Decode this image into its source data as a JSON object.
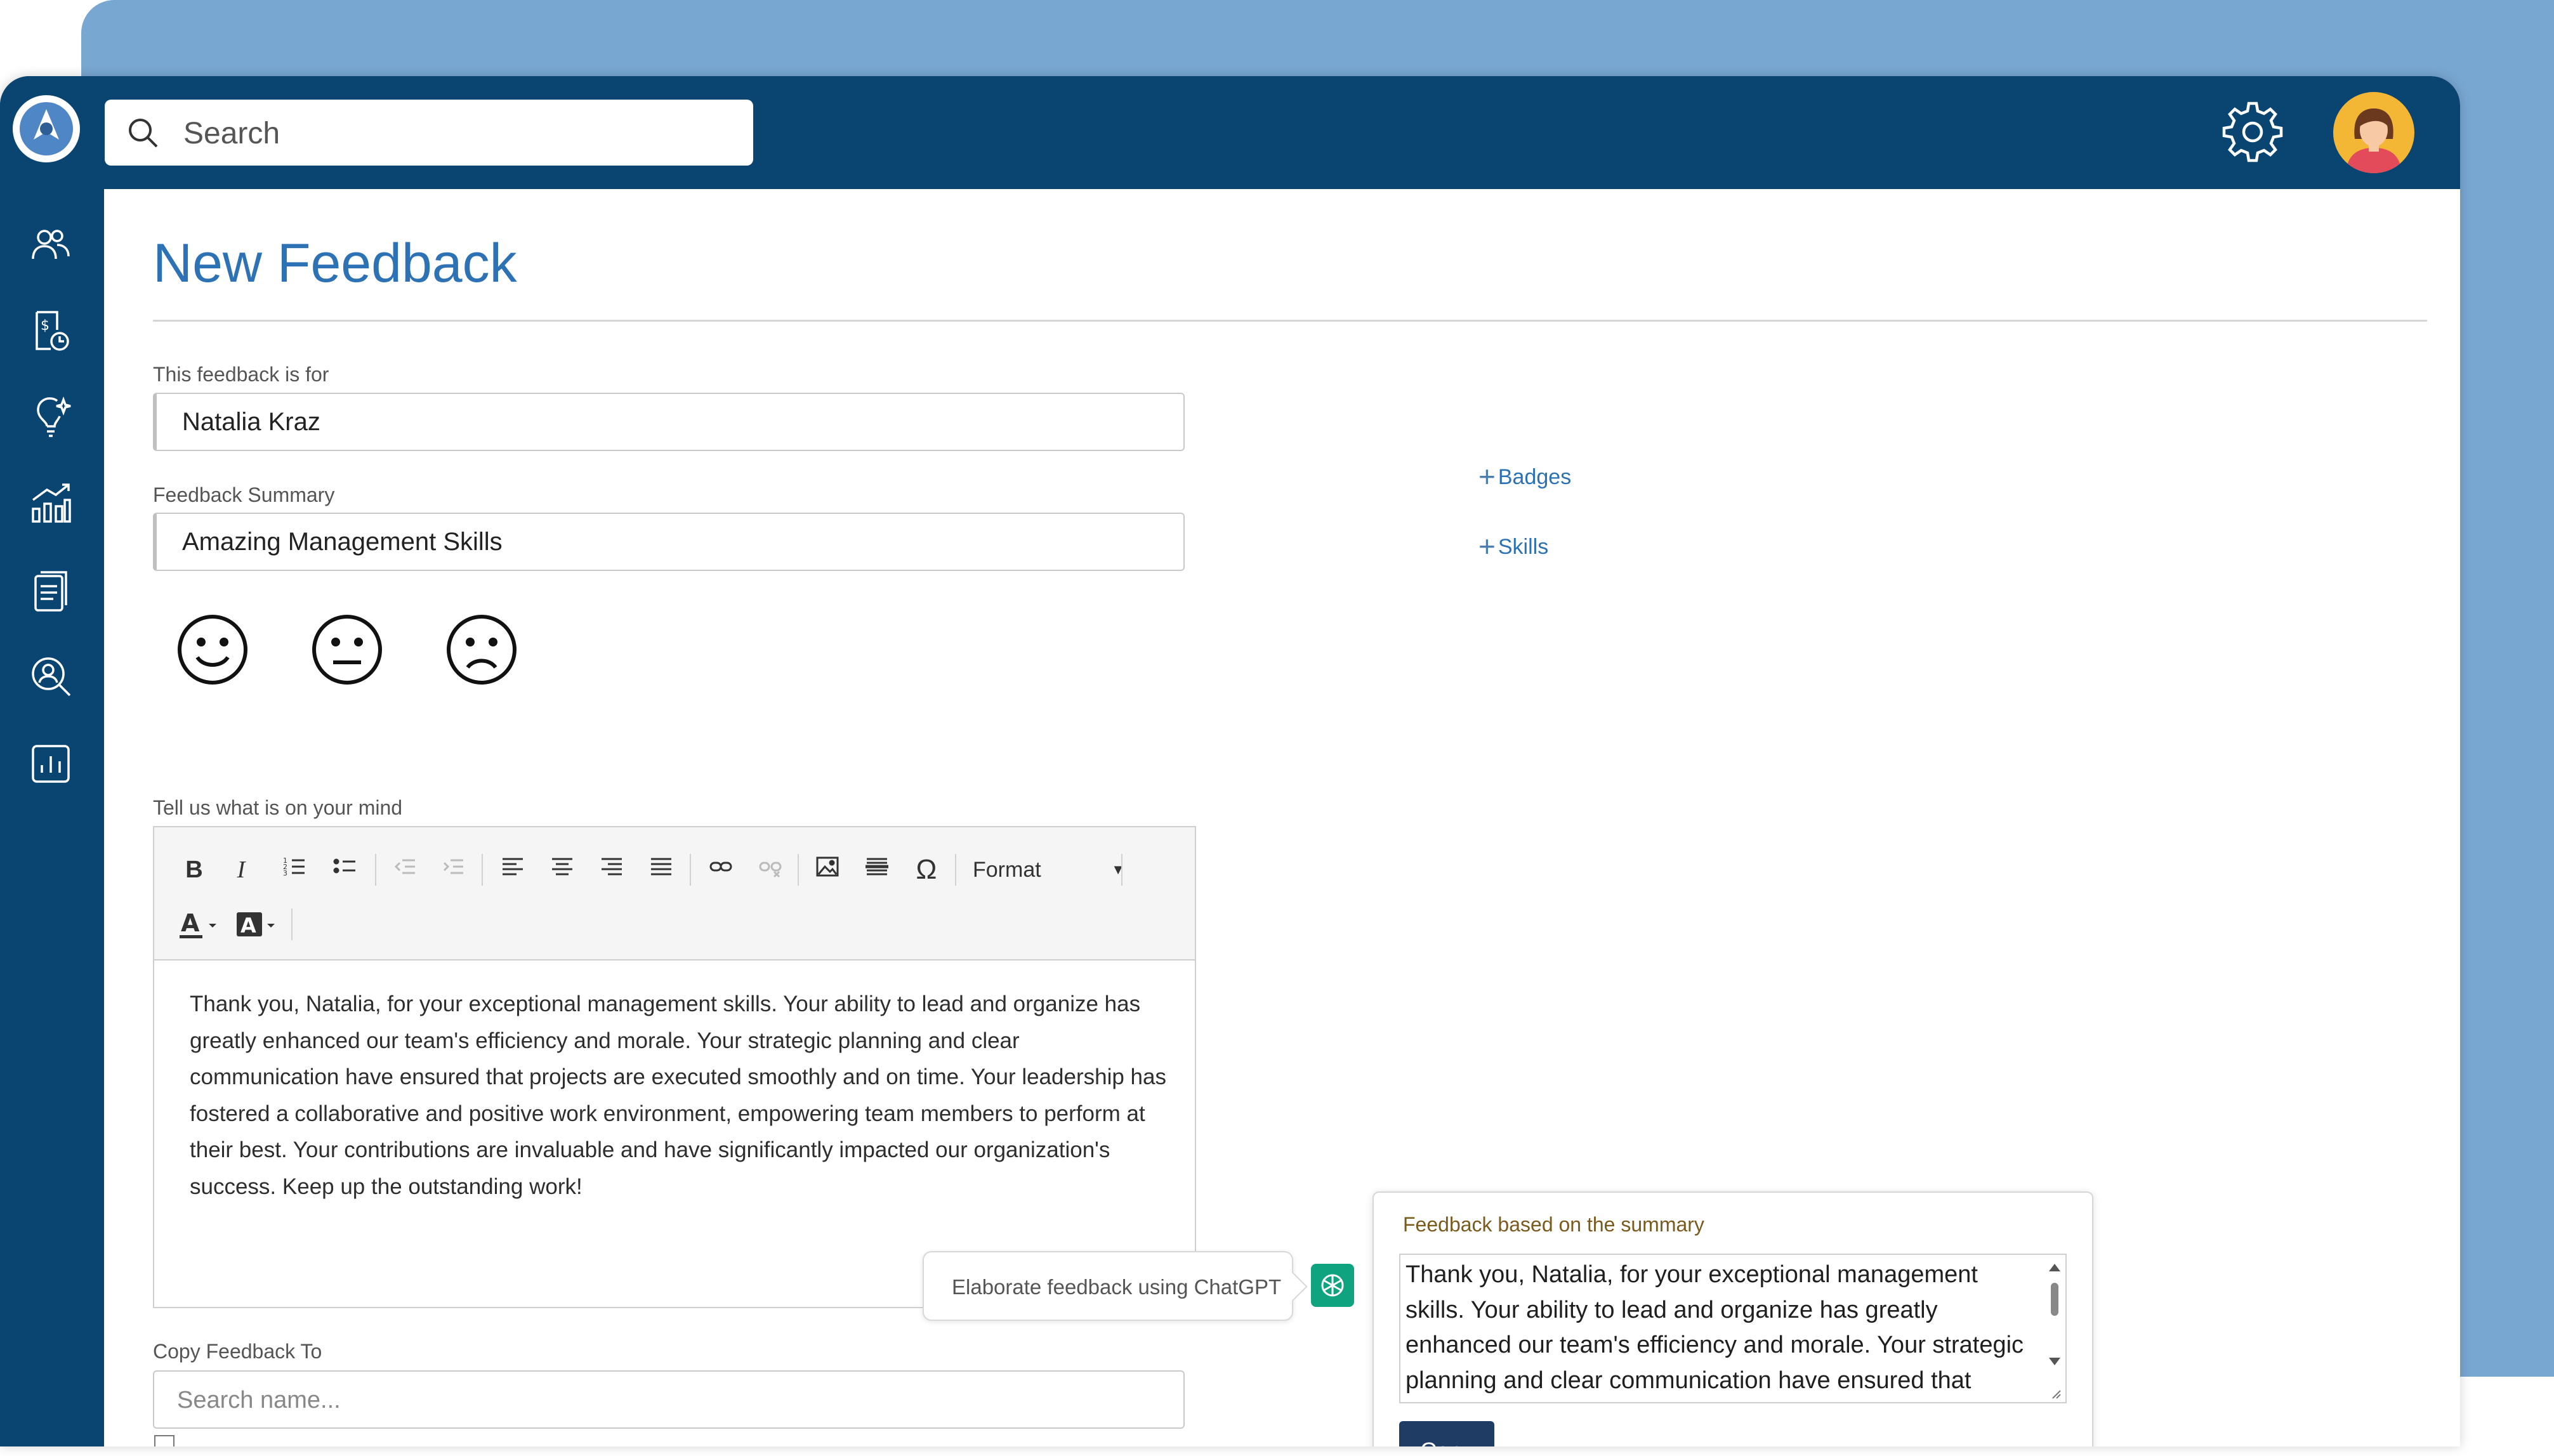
{
  "search": {
    "placeholder": "Search"
  },
  "page": {
    "title": "New Feedback"
  },
  "form": {
    "recipient_label": "This feedback is for",
    "recipient_value": "Natalia Kraz",
    "summary_label": "Feedback Summary",
    "summary_value": "Amazing Management Skills",
    "mind_label": "Tell us what is on your mind",
    "editor_text": "Thank you, Natalia, for your exceptional management skills. Your ability to lead and organize has greatly enhanced our team's efficiency and morale. Your strategic planning and clear communication have ensured that projects are executed smoothly and on time. Your leadership has fostered a collaborative and positive work environment, empowering team members to perform at their best. Your contributions are invaluable and have significantly impacted our organization's success. Keep up the outstanding work!",
    "copy_to_label": "Copy Feedback To",
    "copy_to_placeholder": "Search name..."
  },
  "toolbar": {
    "bold": "B",
    "italic": "I",
    "special_char": "Ω",
    "format_label": "Format"
  },
  "links": {
    "badges": "Badges",
    "skills": "Skills"
  },
  "chatgpt": {
    "tooltip": "Elaborate feedback using ChatGPT",
    "panel_title": "Feedback based on the summary",
    "panel_text": "Thank you, Natalia, for your exceptional management skills. Your ability to lead and organize has greatly enhanced our team's efficiency and morale. Your strategic planning and clear communication have ensured that projects are executed smoothly and on time.",
    "copy_label": "Copy"
  },
  "colors": {
    "navy": "#0a4571",
    "background_panel": "#78a7d2",
    "title_blue": "#2d72b4",
    "chatgpt_green": "#10a37f",
    "copy_button": "#1e3c64"
  },
  "sidebar_icons": [
    "users-icon",
    "invoice-clock-icon",
    "lightbulb-sparkle-icon",
    "bar-chart-growth-icon",
    "document-list-icon",
    "people-search-icon",
    "analytics-chart-icon"
  ]
}
